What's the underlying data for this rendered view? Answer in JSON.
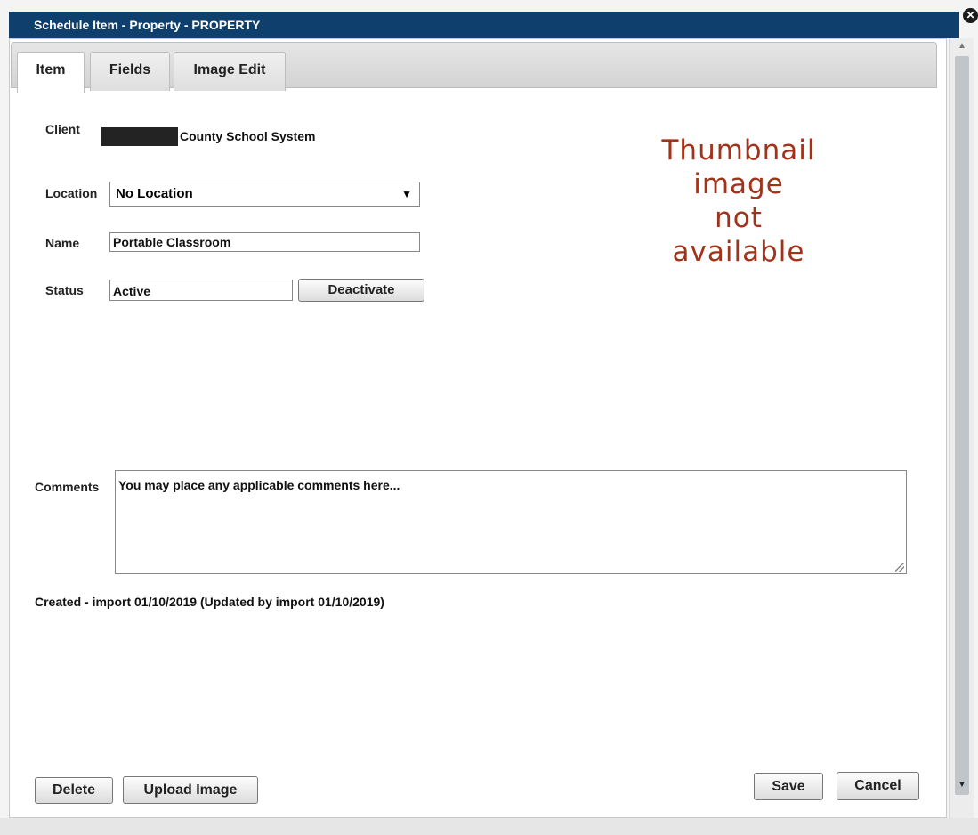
{
  "window": {
    "title": "Schedule Item - Property - PROPERTY",
    "close_symbol": "✕"
  },
  "tabs": [
    {
      "label": "Item",
      "active": true
    },
    {
      "label": "Fields",
      "active": false
    },
    {
      "label": "Image Edit",
      "active": false
    }
  ],
  "form": {
    "client_label": "Client",
    "client_value": "County School System",
    "location_label": "Location",
    "location_value": "No Location",
    "name_label": "Name",
    "name_value": "Portable Classroom",
    "status_label": "Status",
    "status_value": "Active",
    "deactivate_label": "Deactivate",
    "comments_label": "Comments",
    "comments_placeholder": "You may place any applicable comments here..."
  },
  "thumbnail": {
    "line1": "Thumbnail",
    "line2": "image",
    "line3": "not",
    "line4": "available",
    "color": "#a2331b"
  },
  "audit": "Created - import 01/10/2019 (Updated by import 01/10/2019)",
  "buttons": {
    "delete": "Delete",
    "upload_image": "Upload Image",
    "save": "Save",
    "cancel": "Cancel"
  },
  "icons": {
    "dropdown": "▼",
    "scroll_up": "▲",
    "scroll_down": "▼"
  },
  "colors": {
    "titlebar": "#0e3f6d"
  }
}
